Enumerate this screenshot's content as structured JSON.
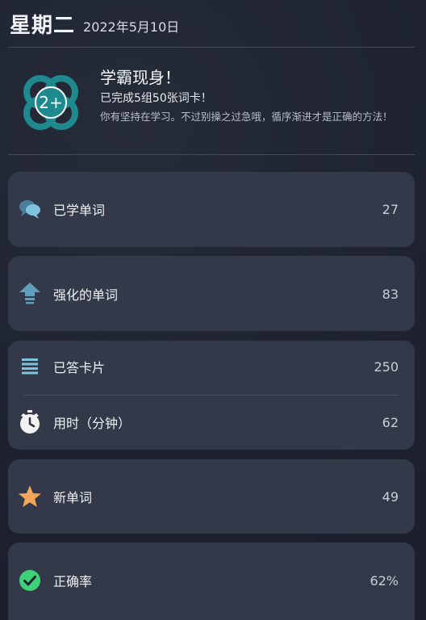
{
  "header": {
    "weekday": "星期二",
    "date": "2022年5月10日"
  },
  "achievement": {
    "badge_text": "2+",
    "title": "学霸现身！",
    "subtitle": "已完成5组50张词卡！",
    "description": "你有坚持在学习。不过别操之过急哦，循序渐进才是正确的方法！"
  },
  "stats": [
    {
      "label": "已学单词",
      "value": "27",
      "icon": "chat-bubbles-icon"
    },
    {
      "label": "强化的单词",
      "value": "83",
      "icon": "arrow-up-icon"
    },
    {
      "label": "已答卡片",
      "value": "250",
      "icon": "list-icon"
    },
    {
      "label": "用时（分钟）",
      "value": "62",
      "icon": "stopwatch-icon"
    },
    {
      "label": "新单词",
      "value": "49",
      "icon": "star-icon"
    },
    {
      "label": "正确率",
      "value": "62%",
      "icon": "check-circle-icon"
    }
  ],
  "colors": {
    "badge": "#1e8a8f",
    "star": "#f3a55b",
    "check": "#3ed17a",
    "icon_blue": "#7fc2de"
  }
}
